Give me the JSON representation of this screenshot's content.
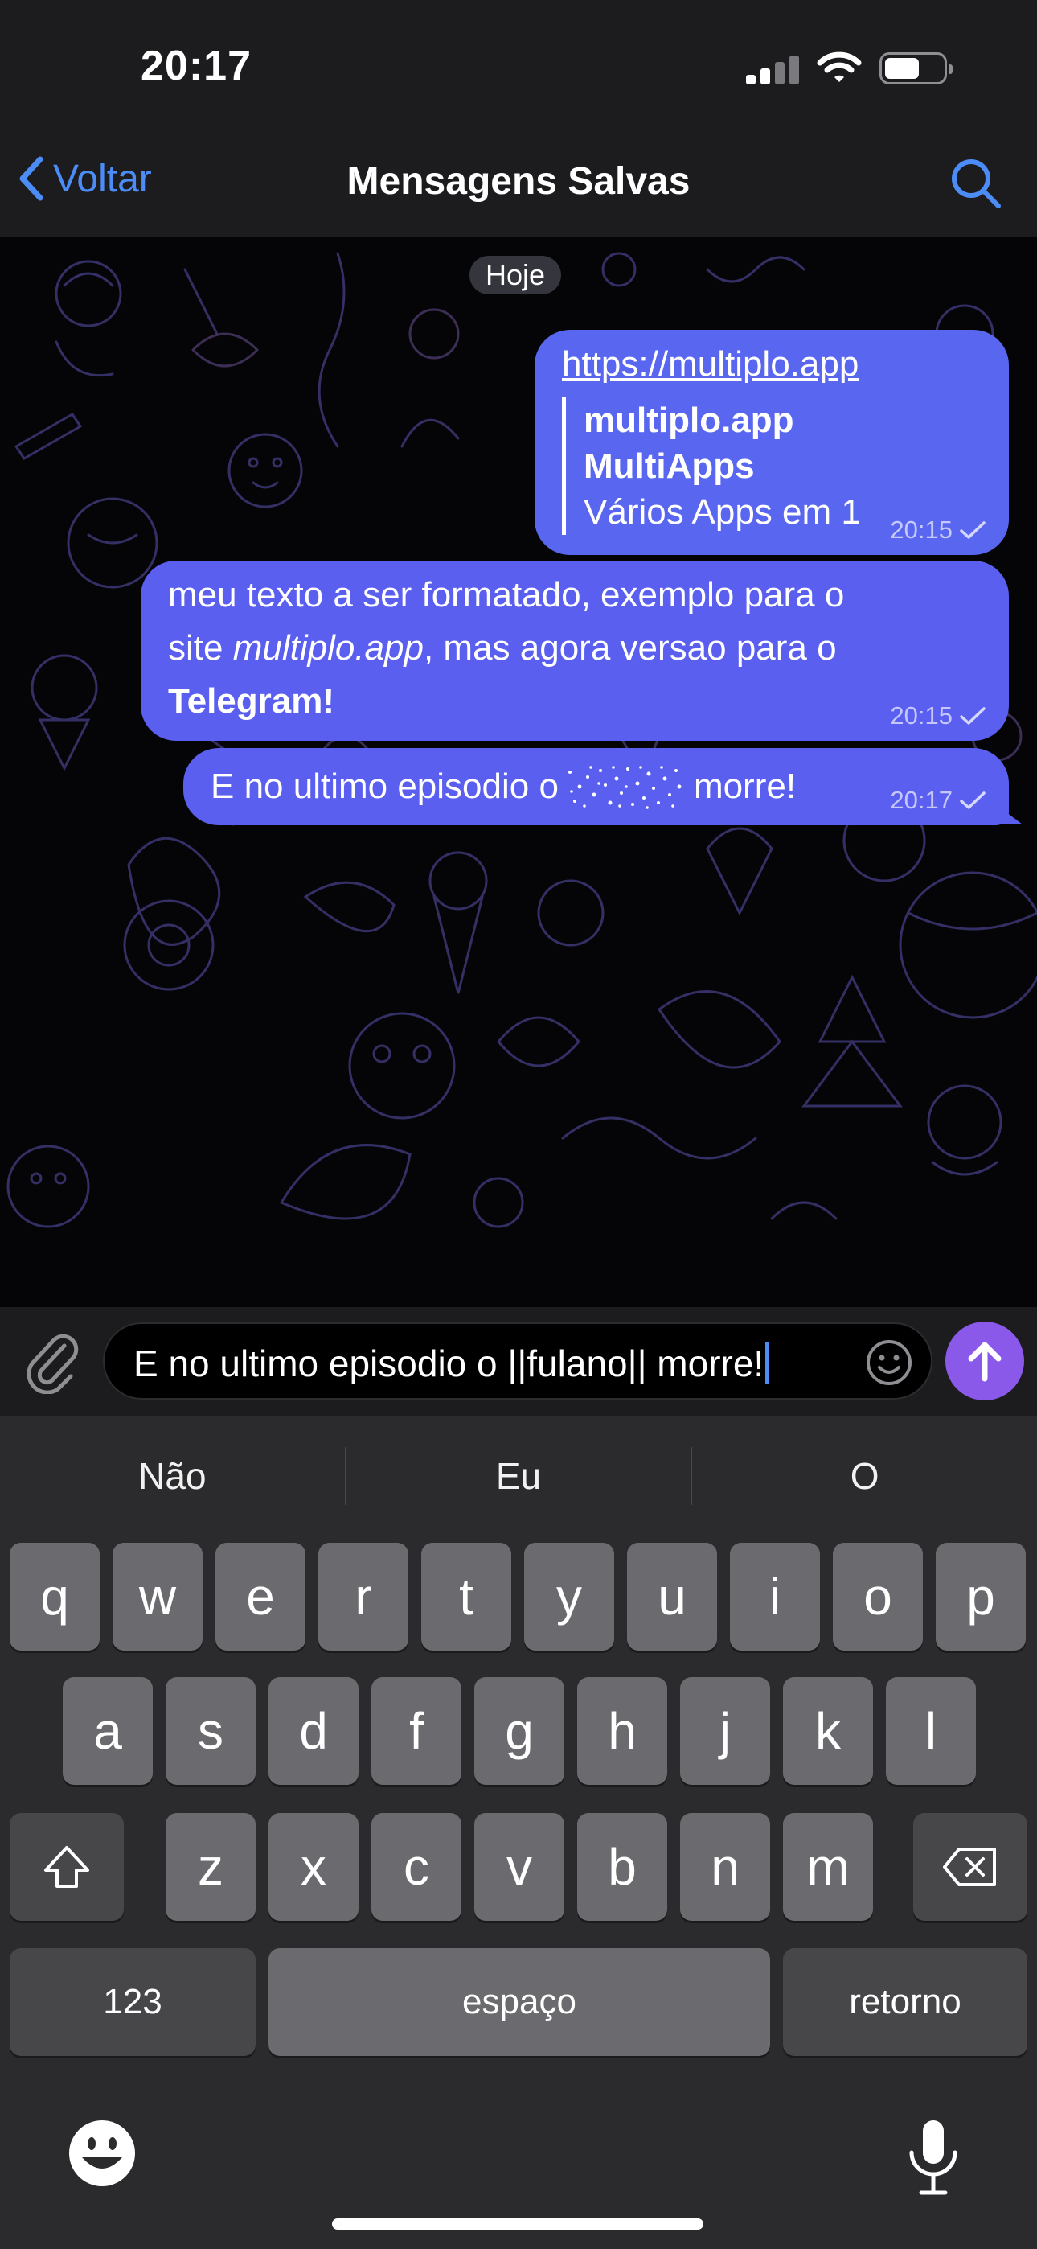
{
  "status_bar": {
    "time": "20:17"
  },
  "nav": {
    "back_label": "Voltar",
    "title": "Mensagens Salvas"
  },
  "chat": {
    "date_label": "Hoje",
    "messages": [
      {
        "link": "https://multiplo.app",
        "preview": {
          "site": "multiplo.app",
          "title": "MultiApps",
          "description": "Vários Apps em 1"
        },
        "time": "20:15"
      },
      {
        "line1": "meu texto a ser formatado, exemplo para o",
        "line2_pre": "site ",
        "line2_italic": "multiplo.app",
        "line2_post": ", mas agora versao para o",
        "line3_bold": "Telegram!",
        "time": "20:15"
      },
      {
        "text_before": "E no ultimo episodio o",
        "text_after": "morre!",
        "time": "20:17"
      }
    ]
  },
  "composer": {
    "input_value": "E no ultimo episodio o ||fulano|| morre!"
  },
  "keyboard": {
    "suggestions": [
      "Não",
      "Eu",
      "O"
    ],
    "row1": [
      "q",
      "w",
      "e",
      "r",
      "t",
      "y",
      "u",
      "i",
      "o",
      "p"
    ],
    "row2": [
      "a",
      "s",
      "d",
      "f",
      "g",
      "h",
      "j",
      "k",
      "l"
    ],
    "row3": [
      "z",
      "x",
      "c",
      "v",
      "b",
      "n",
      "m"
    ],
    "numbers_label": "123",
    "space_label": "espaço",
    "return_label": "retorno"
  },
  "icons": {
    "back": "chevron-left-icon",
    "search": "search-icon",
    "attach": "paperclip-icon",
    "emoji": "emoji-icon",
    "send": "arrow-up-icon",
    "shift": "shift-icon",
    "delete": "delete-icon",
    "mic": "microphone-icon"
  },
  "colors": {
    "accent": "#4c8cf7",
    "bubble": "#5a5ff0",
    "send_button": "#8a59ea"
  }
}
